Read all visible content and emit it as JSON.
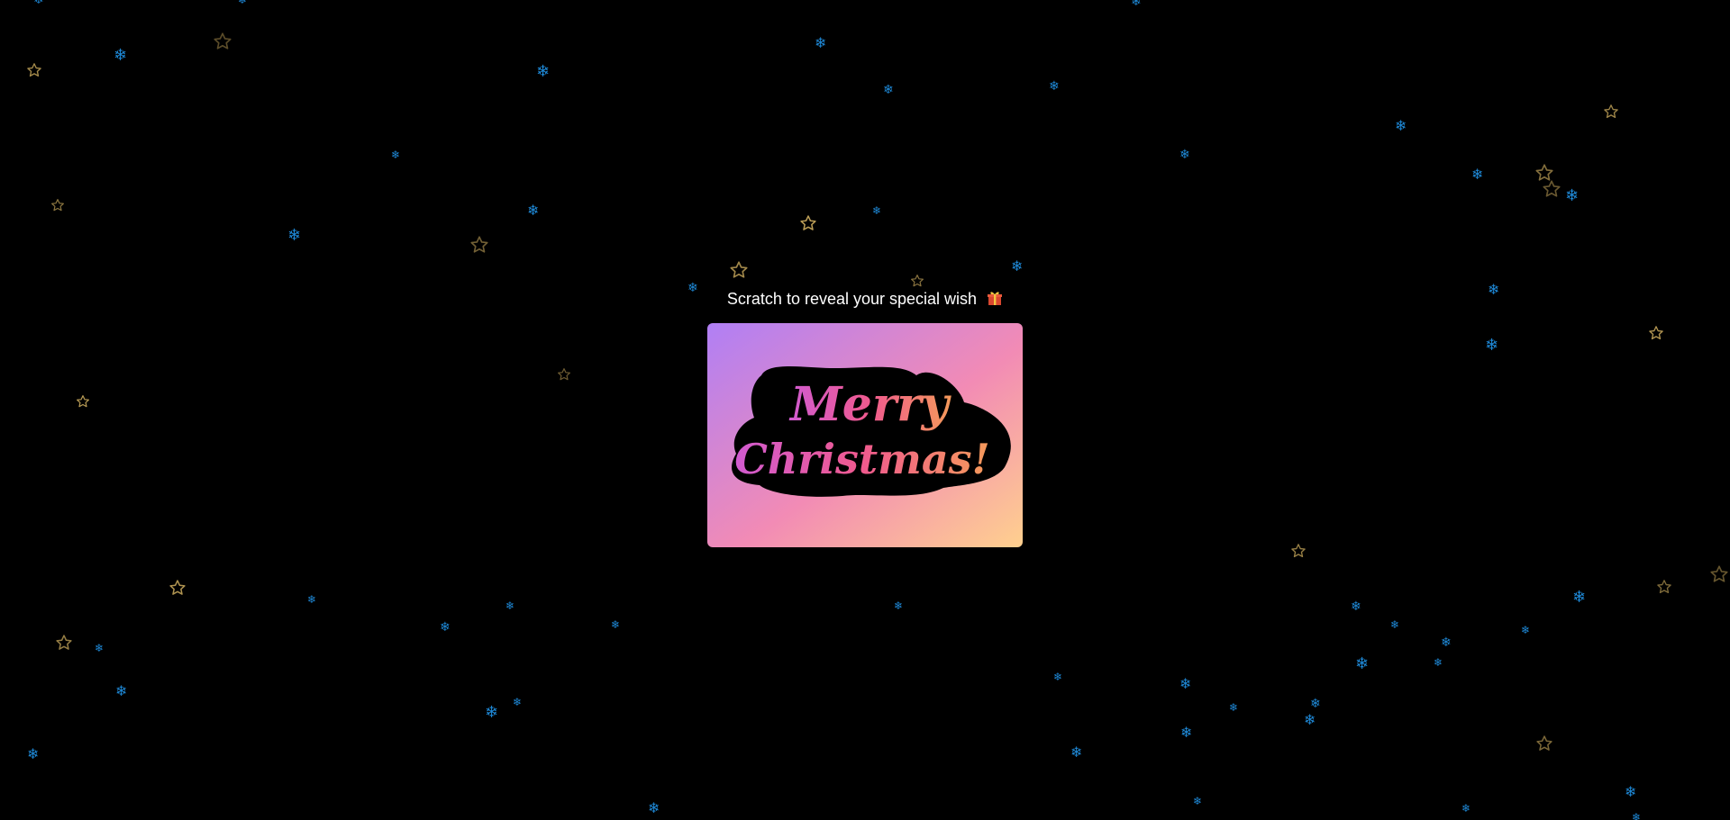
{
  "page": {
    "background_color": "#000000"
  },
  "instruction": {
    "text": "Scratch to reveal your special wish",
    "icon": "gift-icon"
  },
  "card": {
    "message_line1": "Merry",
    "message_line2": "Christmas!",
    "gradient_colors": [
      "#b07ff5",
      "#f28bb5",
      "#ffd08e"
    ],
    "text_gradient_colors": [
      "#d15bd1",
      "#f05a8e",
      "#f59a5a"
    ],
    "blob_color": "#000000"
  },
  "decorations": {
    "snowflake_icon": "snowflake-icon",
    "snowflake_color": "#1e88d6",
    "star_icon": "star-icon",
    "star_color": "#c9a95c"
  }
}
